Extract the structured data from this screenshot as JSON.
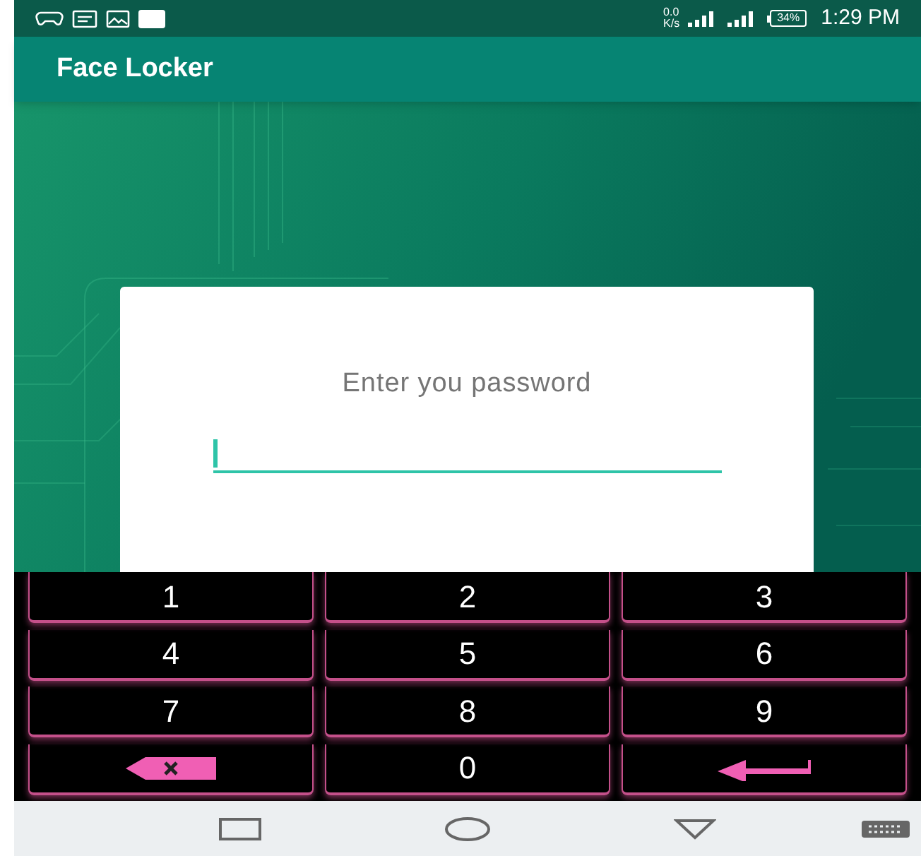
{
  "status_bar": {
    "network_speed_value": "0.0",
    "network_speed_unit": "K/s",
    "battery": "34%",
    "time": "1:29 PM"
  },
  "app_bar": {
    "title": "Face Locker"
  },
  "dialog": {
    "prompt": "Enter you password",
    "password_field": {
      "focused": true
    }
  },
  "keypad": [
    {
      "kind": "digit",
      "label": "1"
    },
    {
      "kind": "digit",
      "label": "2"
    },
    {
      "kind": "digit",
      "label": "3"
    },
    {
      "kind": "digit",
      "label": "4"
    },
    {
      "kind": "digit",
      "label": "5"
    },
    {
      "kind": "digit",
      "label": "6"
    },
    {
      "kind": "digit",
      "label": "7"
    },
    {
      "kind": "digit",
      "label": "8"
    },
    {
      "kind": "digit",
      "label": "9"
    },
    {
      "kind": "delete"
    },
    {
      "kind": "digit",
      "label": "0"
    },
    {
      "kind": "enter"
    }
  ]
}
